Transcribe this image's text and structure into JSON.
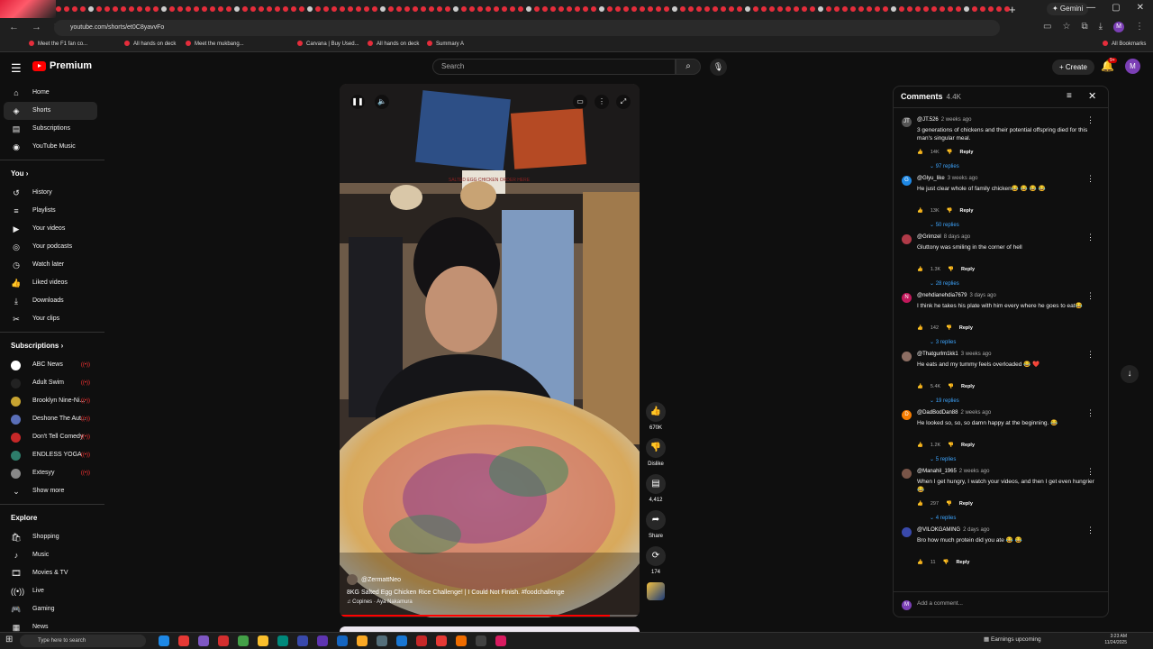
{
  "browser": {
    "new_tab": "+",
    "gemini": "✦ Gemini",
    "url": "youtube.com/shorts/et0C8yavvFo",
    "profile_initial": "M",
    "bookmarks": [
      "Meet the F1 fan co...",
      "All hands on deck",
      "Meet the mukbang...",
      "Carvana | Buy Used...",
      "All hands on deck",
      "Summary A"
    ],
    "all_bookmarks": "All Bookmarks"
  },
  "youtube": {
    "logo_text": "Premium",
    "search_placeholder": "Search",
    "create_label": "Create",
    "notif_badge": "9+",
    "user_initial": "M"
  },
  "sidebar": {
    "main": [
      {
        "icon": "home-icon",
        "glyph": "⌂",
        "label": "Home"
      },
      {
        "icon": "shorts-icon",
        "glyph": "◈",
        "label": "Shorts"
      },
      {
        "icon": "subscriptions-icon",
        "glyph": "▤",
        "label": "Subscriptions"
      },
      {
        "icon": "youtube-music-icon",
        "glyph": "◉",
        "label": "YouTube Music"
      }
    ],
    "you_heading": "You",
    "you": [
      {
        "icon": "history-icon",
        "glyph": "↺",
        "label": "History"
      },
      {
        "icon": "playlists-icon",
        "glyph": "≡",
        "label": "Playlists"
      },
      {
        "icon": "your-videos-icon",
        "glyph": "▶",
        "label": "Your videos"
      },
      {
        "icon": "podcasts-icon",
        "glyph": "◎",
        "label": "Your podcasts"
      },
      {
        "icon": "watch-later-icon",
        "glyph": "◷",
        "label": "Watch later"
      },
      {
        "icon": "liked-videos-icon",
        "glyph": "👍",
        "label": "Liked videos"
      },
      {
        "icon": "downloads-icon",
        "glyph": "⤓",
        "label": "Downloads"
      },
      {
        "icon": "clips-icon",
        "glyph": "✂",
        "label": "Your clips"
      }
    ],
    "subs_heading": "Subscriptions",
    "subs": [
      {
        "label": "ABC News",
        "color": "#ffffff"
      },
      {
        "label": "Adult Swim",
        "color": "#222222"
      },
      {
        "label": "Brooklyn Nine-Ni...",
        "color": "#c8a431"
      },
      {
        "label": "Deshone The Aut...",
        "color": "#5a6fb8"
      },
      {
        "label": "Don't Tell Comedy",
        "color": "#c62828"
      },
      {
        "label": "ENDLESS YOGA",
        "color": "#2e7d6b"
      },
      {
        "label": "Extesyy",
        "color": "#888888"
      }
    ],
    "show_more": "Show more",
    "explore_heading": "Explore",
    "explore": [
      {
        "icon": "shopping-icon",
        "glyph": "🛍",
        "label": "Shopping"
      },
      {
        "icon": "music-icon",
        "glyph": "♪",
        "label": "Music"
      },
      {
        "icon": "movies-icon",
        "glyph": "🎞",
        "label": "Movies & TV"
      },
      {
        "icon": "live-icon",
        "glyph": "((•))",
        "label": "Live"
      },
      {
        "icon": "gaming-icon",
        "glyph": "🎮",
        "label": "Gaming"
      },
      {
        "icon": "news-icon",
        "glyph": "▦",
        "label": "News"
      }
    ]
  },
  "video": {
    "channel": "@ZermattNeo",
    "title": "8KG Salted Egg Chicken Rice Challenge! | I Could Not Finish. #foodchallenge",
    "music": "Copines · Aya Nakamura",
    "progress": 0.9,
    "sign_text": "SALTED EGG CHICKEN ORDER HERE"
  },
  "actions": {
    "likes": "670K",
    "dislike": "Dislike",
    "comments": "4,412",
    "share": "Share",
    "remix": "174"
  },
  "comments": {
    "title": "Comments",
    "count": "4.4K",
    "add_placeholder": "Add a comment...",
    "items": [
      {
        "user": "@JT.526",
        "time": "2 weeks ago",
        "text": "3 generations of chickens and their potential offspring died for this man's singular meal.",
        "likes": "14K",
        "reply": "Reply",
        "replies": "97 replies",
        "avatar": "JT",
        "color": "#555555"
      },
      {
        "user": "@Glyu_like",
        "time": "3 weeks ago",
        "text": "He just clear whole of family chicken😂 😂 😂 😂",
        "likes": "13K",
        "reply": "Reply",
        "replies": "50 replies",
        "avatar": "G",
        "color": "#1e88e5"
      },
      {
        "user": "@Grimzel",
        "time": "8 days ago",
        "text": "Gluttony was smiling in the corner of hell",
        "likes": "1.3K",
        "reply": "Reply",
        "replies": "28 replies",
        "avatar": "",
        "color": "#b03a48"
      },
      {
        "user": "@nehdianehdia7679",
        "time": "3 days ago",
        "text": "I think he takes his plate with him every where he goes to eat😂",
        "likes": "142",
        "reply": "Reply",
        "replies": "3 replies",
        "avatar": "N",
        "color": "#c2185b"
      },
      {
        "user": "@Thatgurlm1kk1",
        "time": "3 weeks ago",
        "text": "He eats and my tummy feels overloaded 😂 ❤️",
        "likes": "5.4K",
        "reply": "Reply",
        "replies": "19 replies",
        "avatar": "",
        "color": "#8d6e63"
      },
      {
        "user": "@DadBodDan88",
        "time": "2 weeks ago",
        "text": "He looked so, so, so damn happy at the beginning. 😂",
        "likes": "1.2K",
        "reply": "Reply",
        "replies": "5 replies",
        "avatar": "D",
        "color": "#f57c00"
      },
      {
        "user": "@Manahil_1965",
        "time": "2 weeks ago",
        "text": "When I get hungry, I watch your videos, and then I get even hungrier😂",
        "likes": "297",
        "reply": "Reply",
        "replies": "4 replies",
        "avatar": "",
        "color": "#795548"
      },
      {
        "user": "@VILOKGAMING",
        "time": "2 days ago",
        "text": "Bro how much protein did you ate 😂 😂",
        "likes": "11",
        "reply": "Reply",
        "replies": "",
        "avatar": "",
        "color": "#3949ab"
      }
    ]
  },
  "taskbar": {
    "search_placeholder": "Type here to search",
    "earnings": "Earnings upcoming",
    "time": "3:23 AM",
    "date": "11/24/2025"
  }
}
